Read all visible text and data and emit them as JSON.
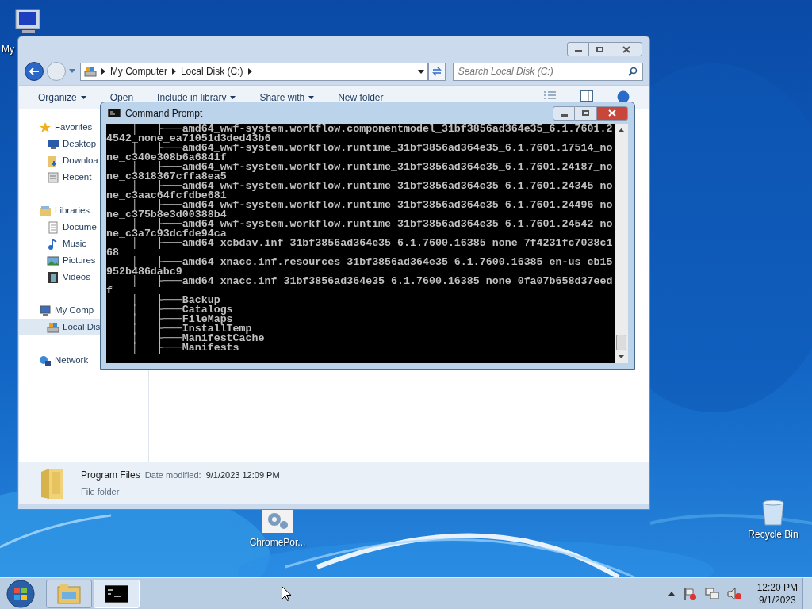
{
  "desktop_icons": [
    {
      "kind": "computer",
      "label": "My"
    },
    {
      "kind": "settings",
      "label": "ChromePor..."
    },
    {
      "kind": "recycle-bin",
      "label": "Recycle Bin"
    }
  ],
  "explorer": {
    "breadcrumb": [
      "My Computer",
      "Local Disk (C:)"
    ],
    "search": {
      "placeholder": "Search Local Disk (C:)"
    },
    "toolbar": [
      {
        "label": "Organize",
        "dropdown": true
      },
      {
        "label": "Open",
        "dropdown": false
      },
      {
        "label": "Include in library",
        "dropdown": true
      },
      {
        "label": "Share with",
        "dropdown": true
      },
      {
        "label": "New folder",
        "dropdown": false
      }
    ],
    "sidebar": [
      {
        "label": "Favorites",
        "kind": "star",
        "selected": false,
        "children": [
          {
            "label": "Desktop",
            "kind": "desktop",
            "selected": false
          },
          {
            "label": "Downloa",
            "kind": "downloads",
            "selected": false
          },
          {
            "label": "Recent",
            "kind": "recent",
            "selected": false
          }
        ]
      },
      {
        "label": "Libraries",
        "kind": "libraries",
        "selected": false,
        "children": [
          {
            "label": "Docume",
            "kind": "document",
            "selected": false
          },
          {
            "label": "Music",
            "kind": "music",
            "selected": false
          },
          {
            "label": "Pictures",
            "kind": "pictures",
            "selected": false
          },
          {
            "label": "Videos",
            "kind": "videos",
            "selected": false
          }
        ]
      },
      {
        "label": "My Comp",
        "kind": "computer",
        "selected": false,
        "children": [
          {
            "label": "Local Dis",
            "kind": "drive",
            "selected": true
          }
        ]
      },
      {
        "label": "Network",
        "kind": "network",
        "selected": false
      }
    ],
    "details": {
      "name": "Program Files",
      "date_label": "Date modified:",
      "date": "9/1/2023 12:09 PM",
      "type": "File folder"
    }
  },
  "cmd": {
    "title": "Command Prompt",
    "lines": [
      "    │   ├───amd64_wwf-system.workflow.componentmodel_31bf3856ad364e35_6.1.7601.2",
      "4542_none_ea71051d3ded43b6",
      "    │   ├───amd64_wwf-system.workflow.runtime_31bf3856ad364e35_6.1.7601.17514_no",
      "ne_c340e308b6a6841f",
      "    │   ├───amd64_wwf-system.workflow.runtime_31bf3856ad364e35_6.1.7601.24187_no",
      "ne_c3818367cffa8ea5",
      "    │   ├───amd64_wwf-system.workflow.runtime_31bf3856ad364e35_6.1.7601.24345_no",
      "ne_c3aac64fcfdbe681",
      "    │   ├───amd64_wwf-system.workflow.runtime_31bf3856ad364e35_6.1.7601.24496_no",
      "ne_c375b8e3d00388b4",
      "    │   ├───amd64_wwf-system.workflow.runtime_31bf3856ad364e35_6.1.7601.24542_no",
      "ne_c3a7c93dcfde94ca",
      "    │   ├───amd64_xcbdav.inf_31bf3856ad364e35_6.1.7600.16385_none_7f4231fc7038c1",
      "68",
      "    │   ├───amd64_xnacc.inf.resources_31bf3856ad364e35_6.1.7600.16385_en-us_eb15",
      "952b486dabc9",
      "    │   ├───amd64_xnacc.inf_31bf3856ad364e35_6.1.7600.16385_none_0fa07b658d37eed",
      "f",
      "    │   ├───Backup",
      "    │   ├───Catalogs",
      "    │   ├───FileMaps",
      "    │   ├───InstallTemp",
      "    │   ├───ManifestCache",
      "    │   ├───Manifests"
    ]
  },
  "taskbar": {
    "buttons": [
      {
        "kind": "explorer",
        "active": false
      },
      {
        "kind": "cmd",
        "active": true
      }
    ],
    "time": "12:20 PM",
    "date": "9/1/2023"
  }
}
